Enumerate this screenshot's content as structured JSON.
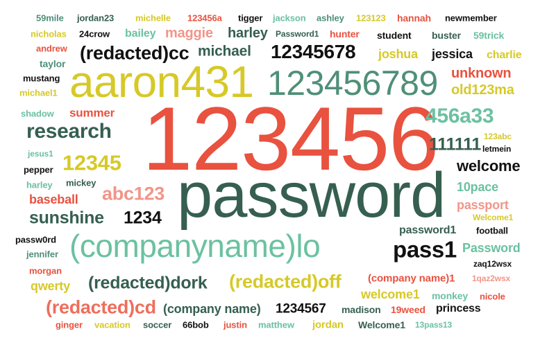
{
  "chart_data": {
    "type": "wordcloud",
    "palette": {
      "red": "#e8523f",
      "dark_green": "#365f50",
      "mid_green": "#4f8f78",
      "teal": "#6bc1a1",
      "yellow": "#d6c928",
      "pink": "#f29589",
      "salmon": "#ee6e5c",
      "black": "#111111"
    },
    "words": [
      {
        "text": "59mile",
        "color": "#4f8f78"
      },
      {
        "text": "jordan23",
        "color": "#365f50"
      },
      {
        "text": "michelle",
        "color": "#d6c928"
      },
      {
        "text": "123456a",
        "color": "#e8523f"
      },
      {
        "text": "tigger",
        "color": "#111111"
      },
      {
        "text": "jackson",
        "color": "#6bc1a1"
      },
      {
        "text": "ashley",
        "color": "#4f8f78"
      },
      {
        "text": "123123",
        "color": "#d6c928"
      },
      {
        "text": "hannah",
        "color": "#e8523f"
      },
      {
        "text": "newmember",
        "color": "#111111"
      },
      {
        "text": "nicholas",
        "color": "#d6c928"
      },
      {
        "text": "24crow",
        "color": "#111111"
      },
      {
        "text": "bailey",
        "color": "#6bc1a1"
      },
      {
        "text": "maggie",
        "color": "#f29589"
      },
      {
        "text": "harley",
        "color": "#365f50"
      },
      {
        "text": "Password1",
        "color": "#365f50"
      },
      {
        "text": "hunter",
        "color": "#e8523f"
      },
      {
        "text": "student",
        "color": "#111111"
      },
      {
        "text": "buster",
        "color": "#365f50"
      },
      {
        "text": "59trick",
        "color": "#6bc1a1"
      },
      {
        "text": "andrew",
        "color": "#e8523f"
      },
      {
        "text": "(redacted)cc",
        "color": "#111111"
      },
      {
        "text": "michael",
        "color": "#365f50"
      },
      {
        "text": "12345678",
        "color": "#111111"
      },
      {
        "text": "joshua",
        "color": "#d6c928"
      },
      {
        "text": "jessica",
        "color": "#111111"
      },
      {
        "text": "charlie",
        "color": "#d6c928"
      },
      {
        "text": "taylor",
        "color": "#4f8f78"
      },
      {
        "text": "mustang",
        "color": "#111111"
      },
      {
        "text": "michael1",
        "color": "#d6c928"
      },
      {
        "text": "aaron431",
        "color": "#d6c928"
      },
      {
        "text": "123456789",
        "color": "#4f8f78"
      },
      {
        "text": "unknown",
        "color": "#e8523f"
      },
      {
        "text": "old123ma",
        "color": "#d6c928"
      },
      {
        "text": "shadow",
        "color": "#6bc1a1"
      },
      {
        "text": "summer",
        "color": "#e8523f"
      },
      {
        "text": "123456",
        "color": "#e8523f"
      },
      {
        "text": "456a33",
        "color": "#6bc1a1"
      },
      {
        "text": "research",
        "color": "#365f50"
      },
      {
        "text": "123abc",
        "color": "#d6c928"
      },
      {
        "text": "letmein",
        "color": "#111111"
      },
      {
        "text": "111111",
        "color": "#365f50"
      },
      {
        "text": "jesus1",
        "color": "#6bc1a1"
      },
      {
        "text": "12345",
        "color": "#d6c928"
      },
      {
        "text": "pepper",
        "color": "#111111"
      },
      {
        "text": "harley",
        "color": "#6bc1a1"
      },
      {
        "text": "mickey",
        "color": "#365f50"
      },
      {
        "text": "welcome",
        "color": "#111111"
      },
      {
        "text": "password",
        "color": "#365f50"
      },
      {
        "text": "abc123",
        "color": "#f29589"
      },
      {
        "text": "10pace",
        "color": "#6bc1a1"
      },
      {
        "text": "baseball",
        "color": "#e8523f"
      },
      {
        "text": "passport",
        "color": "#f29589"
      },
      {
        "text": "sunshine",
        "color": "#365f50"
      },
      {
        "text": "1234",
        "color": "#111111"
      },
      {
        "text": "Welcome1",
        "color": "#d6c928"
      },
      {
        "text": "password1",
        "color": "#365f50"
      },
      {
        "text": "football",
        "color": "#111111"
      },
      {
        "text": "passw0rd",
        "color": "#111111"
      },
      {
        "text": "(companyname)lo",
        "color": "#6bc1a1"
      },
      {
        "text": "pass1",
        "color": "#111111"
      },
      {
        "text": "Password",
        "color": "#6bc1a1"
      },
      {
        "text": "jennifer",
        "color": "#4f8f78"
      },
      {
        "text": "zaq12wsx",
        "color": "#111111"
      },
      {
        "text": "morgan",
        "color": "#e8523f"
      },
      {
        "text": "(redacted)dork",
        "color": "#365f50"
      },
      {
        "text": "(redacted)off",
        "color": "#d6c928"
      },
      {
        "text": "(company name)1",
        "color": "#e8523f"
      },
      {
        "text": "1qaz2wsx",
        "color": "#f29589"
      },
      {
        "text": "qwerty",
        "color": "#d6c928"
      },
      {
        "text": "welcome1",
        "color": "#d6c928"
      },
      {
        "text": "monkey",
        "color": "#6bc1a1"
      },
      {
        "text": "nicole",
        "color": "#e8523f"
      },
      {
        "text": "(redacted)cd",
        "color": "#ee6e5c"
      },
      {
        "text": "(company name)",
        "color": "#365f50"
      },
      {
        "text": "1234567",
        "color": "#111111"
      },
      {
        "text": "madison",
        "color": "#365f50"
      },
      {
        "text": "19weed",
        "color": "#e8523f"
      },
      {
        "text": "princess",
        "color": "#111111"
      },
      {
        "text": "ginger",
        "color": "#e8523f"
      },
      {
        "text": "vacation",
        "color": "#d6c928"
      },
      {
        "text": "soccer",
        "color": "#365f50"
      },
      {
        "text": "66bob",
        "color": "#111111"
      },
      {
        "text": "justin",
        "color": "#e8523f"
      },
      {
        "text": "matthew",
        "color": "#6bc1a1"
      },
      {
        "text": "jordan",
        "color": "#d6c928"
      },
      {
        "text": "Welcome1",
        "color": "#365f50"
      },
      {
        "text": "13pass13",
        "color": "#6bc1a1"
      }
    ]
  }
}
